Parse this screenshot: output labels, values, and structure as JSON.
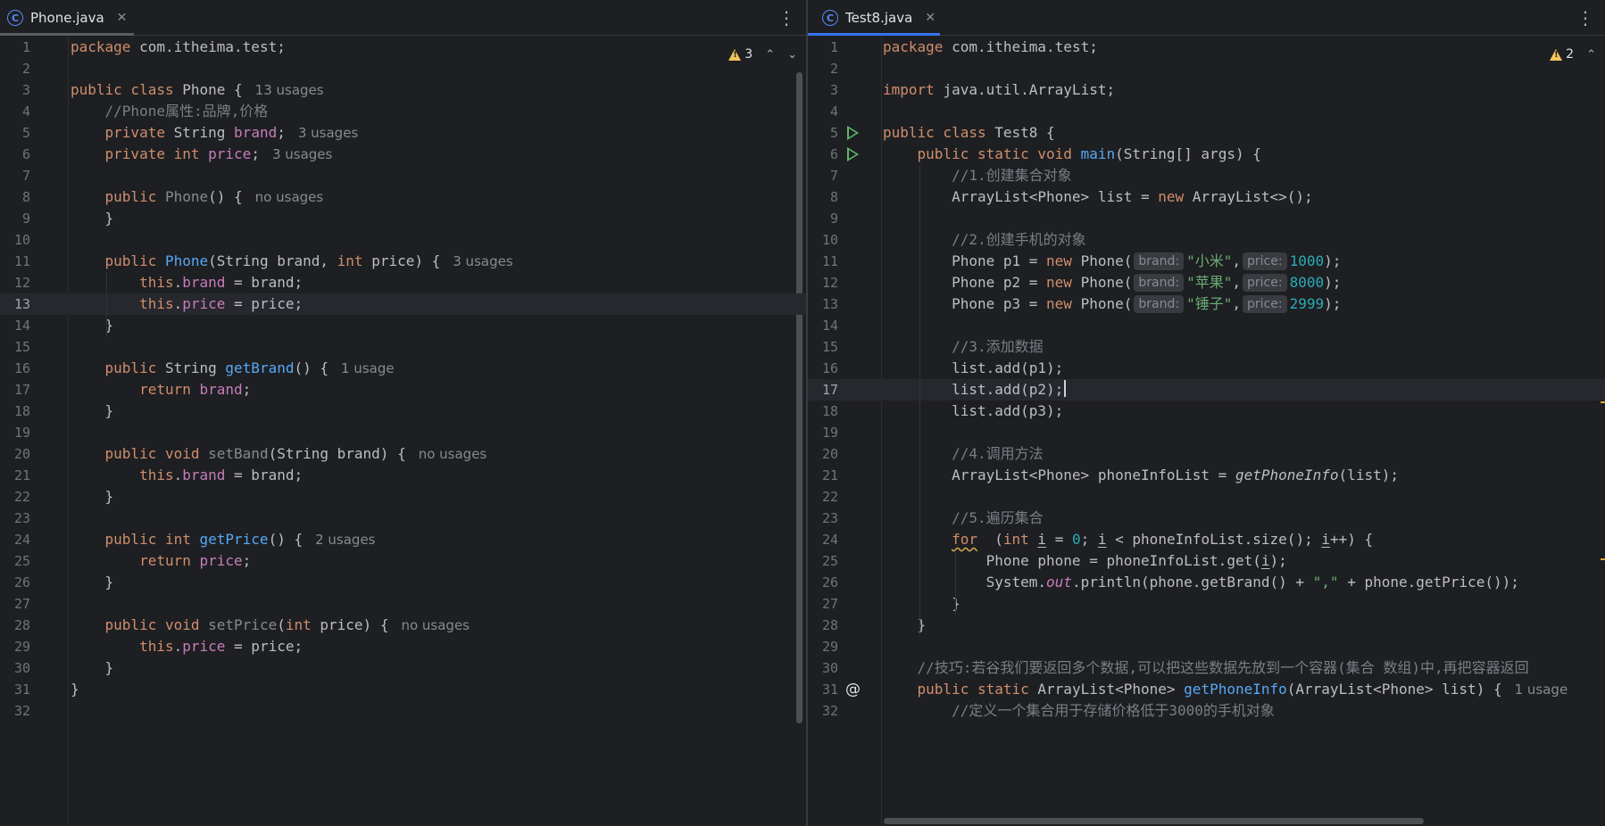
{
  "left": {
    "tab": {
      "icon_letter": "C",
      "title": "Phone.java"
    },
    "warnings": "3",
    "lines": [
      {
        "n": "1",
        "t": [
          [
            "kw",
            "package"
          ],
          [
            "",
            "com.itheima.test;"
          ]
        ]
      },
      {
        "n": "2",
        "t": []
      },
      {
        "n": "3",
        "t": [
          [
            "kw",
            "public class"
          ],
          [
            "",
            "Phone {"
          ],
          [
            "hint",
            "13 usages"
          ]
        ]
      },
      {
        "n": "4",
        "t": [
          [
            "",
            "    "
          ],
          [
            "cmt",
            "//Phone属性:品牌,价格"
          ]
        ]
      },
      {
        "n": "5",
        "t": [
          [
            "kw",
            "    private"
          ],
          [
            "",
            "String"
          ],
          [
            "fld",
            "brand"
          ],
          [
            ";"
          ],
          [
            "hint",
            "3 usages"
          ]
        ]
      },
      {
        "n": "6",
        "t": [
          [
            "kw",
            "    private int"
          ],
          [
            "fld",
            "price"
          ],
          [
            ";"
          ],
          [
            "hint",
            "3 usages"
          ]
        ]
      },
      {
        "n": "7",
        "t": []
      },
      {
        "n": "8",
        "t": [
          [
            "kw",
            "    public"
          ],
          [
            "unused",
            "Phone"
          ],
          [
            "",
            "() {"
          ],
          [
            "hint",
            "no usages"
          ]
        ]
      },
      {
        "n": "9",
        "t": [
          [
            "",
            "    }"
          ]
        ]
      },
      {
        "n": "10",
        "t": []
      },
      {
        "n": "11",
        "t": [
          [
            "kw",
            "    public"
          ],
          [
            "fn",
            "Phone"
          ],
          [
            "",
            "(String brand, "
          ],
          [
            "kw",
            "int"
          ],
          [
            "",
            "price) {"
          ],
          [
            "hint",
            "3 usages"
          ]
        ]
      },
      {
        "n": "12",
        "t": [
          [
            "kw",
            "        this"
          ],
          [
            "",
            "."
          ],
          [
            "fld",
            "brand"
          ],
          [
            "",
            " = brand;"
          ]
        ]
      },
      {
        "n": "13",
        "t": [
          [
            "kw",
            "        this"
          ],
          [
            "",
            "."
          ],
          [
            "fld",
            "price"
          ],
          [
            "",
            " = price;"
          ]
        ],
        "cur": true
      },
      {
        "n": "14",
        "t": [
          [
            "",
            "    }"
          ]
        ]
      },
      {
        "n": "15",
        "t": []
      },
      {
        "n": "16",
        "t": [
          [
            "kw",
            "    public"
          ],
          [
            "",
            "String"
          ],
          [
            "fn",
            "getBrand"
          ],
          [
            "",
            "() {"
          ],
          [
            "hint",
            "1 usage"
          ]
        ]
      },
      {
        "n": "17",
        "t": [
          [
            "kw",
            "        return"
          ],
          [
            "fld",
            "brand"
          ],
          [
            ";"
          ]
        ]
      },
      {
        "n": "18",
        "t": [
          [
            "",
            "    }"
          ]
        ]
      },
      {
        "n": "19",
        "t": []
      },
      {
        "n": "20",
        "t": [
          [
            "kw",
            "    public void"
          ],
          [
            "unused",
            "setBand"
          ],
          [
            "",
            "(String brand) {"
          ],
          [
            "hint",
            "no usages"
          ]
        ]
      },
      {
        "n": "21",
        "t": [
          [
            "kw",
            "        this"
          ],
          [
            "",
            "."
          ],
          [
            "fld",
            "brand"
          ],
          [
            "",
            " = brand;"
          ]
        ]
      },
      {
        "n": "22",
        "t": [
          [
            "",
            "    }"
          ]
        ]
      },
      {
        "n": "23",
        "t": []
      },
      {
        "n": "24",
        "t": [
          [
            "kw",
            "    public int"
          ],
          [
            "fn",
            "getPrice"
          ],
          [
            "",
            "() {"
          ],
          [
            "hint",
            "2 usages"
          ]
        ]
      },
      {
        "n": "25",
        "t": [
          [
            "kw",
            "        return"
          ],
          [
            "fld",
            "price"
          ],
          [
            ";"
          ]
        ]
      },
      {
        "n": "26",
        "t": [
          [
            "",
            "    }"
          ]
        ]
      },
      {
        "n": "27",
        "t": []
      },
      {
        "n": "28",
        "t": [
          [
            "kw",
            "    public void"
          ],
          [
            "unused",
            "setPrice"
          ],
          [
            "",
            "("
          ],
          [
            "kw",
            "int"
          ],
          [
            "",
            "price) {"
          ],
          [
            "hint",
            "no usages"
          ]
        ]
      },
      {
        "n": "29",
        "t": [
          [
            "kw",
            "        this"
          ],
          [
            "",
            "."
          ],
          [
            "fld",
            "price"
          ],
          [
            "",
            " = price;"
          ]
        ]
      },
      {
        "n": "30",
        "t": [
          [
            "",
            "    }"
          ]
        ]
      },
      {
        "n": "31",
        "t": [
          [
            "",
            "}"
          ]
        ]
      },
      {
        "n": "32",
        "t": []
      }
    ]
  },
  "right": {
    "tab": {
      "icon_letter": "C",
      "title": "Test8.java"
    },
    "warnings": "2",
    "lines": [
      {
        "n": "1",
        "t": [
          [
            "kw",
            "package"
          ],
          [
            "",
            "com.itheima.test;"
          ]
        ]
      },
      {
        "n": "2",
        "t": []
      },
      {
        "n": "3",
        "t": [
          [
            "kw",
            "import"
          ],
          [
            "",
            "java.util.ArrayList;"
          ]
        ]
      },
      {
        "n": "4",
        "t": []
      },
      {
        "n": "5",
        "t": [
          [
            "kw",
            "public class"
          ],
          [
            "",
            "Test8 {"
          ]
        ],
        "run": true
      },
      {
        "n": "6",
        "t": [
          [
            "kw",
            "    public static void"
          ],
          [
            "fn",
            "main"
          ],
          [
            "",
            "(String[] args) {"
          ]
        ],
        "run": true
      },
      {
        "n": "7",
        "t": [
          [
            "",
            "        "
          ],
          [
            "cmt",
            "//1.创建集合对象"
          ]
        ]
      },
      {
        "n": "8",
        "t": [
          [
            "",
            "        ArrayList<Phone> list = "
          ],
          [
            "kw",
            "new"
          ],
          [
            "",
            "ArrayList<>();"
          ]
        ]
      },
      {
        "n": "9",
        "t": []
      },
      {
        "n": "10",
        "t": [
          [
            "",
            "        "
          ],
          [
            "cmt",
            "//2.创建手机的对象"
          ]
        ]
      },
      {
        "n": "11",
        "t": [
          [
            "",
            "        Phone p1 = "
          ],
          [
            "kw",
            "new"
          ],
          [
            "",
            "Phone("
          ],
          [
            "inlay",
            "brand:"
          ],
          [
            "str",
            "\"小米\""
          ],
          [
            ","
          ],
          [
            "inlay",
            "price:"
          ],
          [
            "num",
            "1000"
          ],
          [
            ");"
          ]
        ]
      },
      {
        "n": "12",
        "t": [
          [
            "",
            "        Phone p2 = "
          ],
          [
            "kw",
            "new"
          ],
          [
            "",
            "Phone("
          ],
          [
            "inlay",
            "brand:"
          ],
          [
            "str",
            "\"苹果\""
          ],
          [
            ","
          ],
          [
            "inlay",
            "price:"
          ],
          [
            "num",
            "8000"
          ],
          [
            ");"
          ]
        ]
      },
      {
        "n": "13",
        "t": [
          [
            "",
            "        Phone p3 = "
          ],
          [
            "kw",
            "new"
          ],
          [
            "",
            "Phone("
          ],
          [
            "inlay",
            "brand:"
          ],
          [
            "str",
            "\"锤子\""
          ],
          [
            ","
          ],
          [
            "inlay",
            "price:"
          ],
          [
            "num",
            "2999"
          ],
          [
            ");"
          ]
        ]
      },
      {
        "n": "14",
        "t": []
      },
      {
        "n": "15",
        "t": [
          [
            "",
            "        "
          ],
          [
            "cmt",
            "//3.添加数据"
          ]
        ]
      },
      {
        "n": "16",
        "t": [
          [
            "",
            "        list.add(p1);"
          ]
        ]
      },
      {
        "n": "17",
        "t": [
          [
            "",
            "        list.add(p2);"
          ],
          [
            "caret",
            ""
          ]
        ],
        "cur": true
      },
      {
        "n": "18",
        "t": [
          [
            "",
            "        list.add(p3);"
          ]
        ]
      },
      {
        "n": "19",
        "t": []
      },
      {
        "n": "20",
        "t": [
          [
            "",
            "        "
          ],
          [
            "cmt",
            "//4.调用方法"
          ]
        ]
      },
      {
        "n": "21",
        "t": [
          [
            "",
            "        ArrayList<Phone> phoneInfoList = "
          ],
          [
            "ital",
            "getPhoneInfo"
          ],
          [
            "",
            "(list);"
          ]
        ]
      },
      {
        "n": "22",
        "t": []
      },
      {
        "n": "23",
        "t": [
          [
            "",
            "        "
          ],
          [
            "cmt",
            "//5.遍历集合"
          ]
        ]
      },
      {
        "n": "24",
        "t": [
          [
            "",
            "        "
          ],
          [
            "kwwavy",
            "for"
          ],
          [
            "",
            " ("
          ],
          [
            "kw",
            "int"
          ],
          [
            "ul",
            "i"
          ],
          [
            "",
            " = "
          ],
          [
            "num",
            "0"
          ],
          [
            "",
            "; "
          ],
          [
            "ul",
            "i"
          ],
          [
            "",
            " < phoneInfoList.size(); "
          ],
          [
            "ul",
            "i"
          ],
          [
            "",
            "++) {"
          ]
        ]
      },
      {
        "n": "25",
        "t": [
          [
            "",
            "            Phone phone = phoneInfoList.get("
          ],
          [
            "ul",
            "i"
          ],
          [
            "",
            ");"
          ]
        ]
      },
      {
        "n": "26",
        "t": [
          [
            "",
            "            System."
          ],
          [
            "sfld",
            "out"
          ],
          [
            "",
            ".println(phone.getBrand() + "
          ],
          [
            "str",
            "\",\""
          ],
          [
            "",
            " + phone.getPrice());"
          ]
        ]
      },
      {
        "n": "27",
        "t": [
          [
            "",
            "        }"
          ]
        ]
      },
      {
        "n": "28",
        "t": [
          [
            "",
            "    }"
          ]
        ]
      },
      {
        "n": "29",
        "t": []
      },
      {
        "n": "30",
        "t": [
          [
            "",
            "    "
          ],
          [
            "cmt",
            "//技巧:若谷我们要返回多个数据,可以把这些数据先放到一个容器(集合 数组)中,再把容器返回"
          ]
        ]
      },
      {
        "n": "31",
        "t": [
          [
            "kw",
            "    public static"
          ],
          [
            "",
            "ArrayList<Phone>"
          ],
          [
            "fn",
            "getPhoneInfo"
          ],
          [
            "",
            "(ArrayList<Phone> list) {"
          ],
          [
            "hint",
            "1 usage"
          ]
        ],
        "at": true
      },
      {
        "n": "32",
        "t": [
          [
            "",
            "        "
          ],
          [
            "cmt",
            "//定义一个集合用于存储价格低于3000的手机对象"
          ]
        ]
      }
    ]
  },
  "icons": {
    "more": "⋮",
    "close": "✕",
    "up": "⌃",
    "down": "⌄",
    "at": "@"
  }
}
